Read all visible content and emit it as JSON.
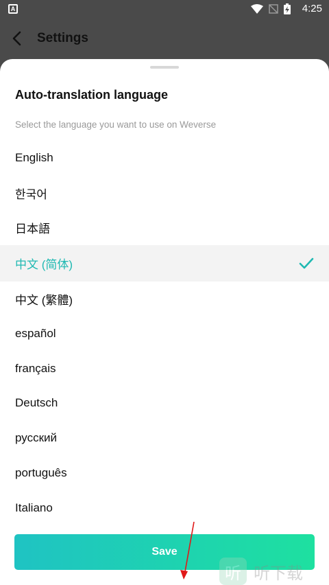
{
  "status_bar": {
    "left_icon_letter": "A",
    "time": "4:25",
    "icons": [
      "wifi-icon",
      "signal-off-icon",
      "battery-charging-icon"
    ]
  },
  "header": {
    "title": "Settings"
  },
  "sheet": {
    "title": "Auto-translation language",
    "subtitle": "Select the language you want to use on Weverse",
    "languages": [
      {
        "label": "English",
        "selected": false
      },
      {
        "label": "한국어",
        "selected": false
      },
      {
        "label": "日本語",
        "selected": false
      },
      {
        "label": "中文 (简体)",
        "selected": true
      },
      {
        "label": "中文 (繁體)",
        "selected": false
      },
      {
        "label": "español",
        "selected": false
      },
      {
        "label": "français",
        "selected": false
      },
      {
        "label": "Deutsch",
        "selected": false
      },
      {
        "label": "русский",
        "selected": false
      },
      {
        "label": "português",
        "selected": false
      },
      {
        "label": "Italiano",
        "selected": false
      }
    ],
    "save_label": "Save"
  },
  "watermark": {
    "logo_char": "听",
    "text": "听下载"
  },
  "colors": {
    "accent": "#1fb9b2",
    "button_gradient_start": "#1fc3c3",
    "button_gradient_end": "#1ee0a0",
    "header_bg": "#4a4a4a",
    "annotation_arrow": "#e01818"
  }
}
